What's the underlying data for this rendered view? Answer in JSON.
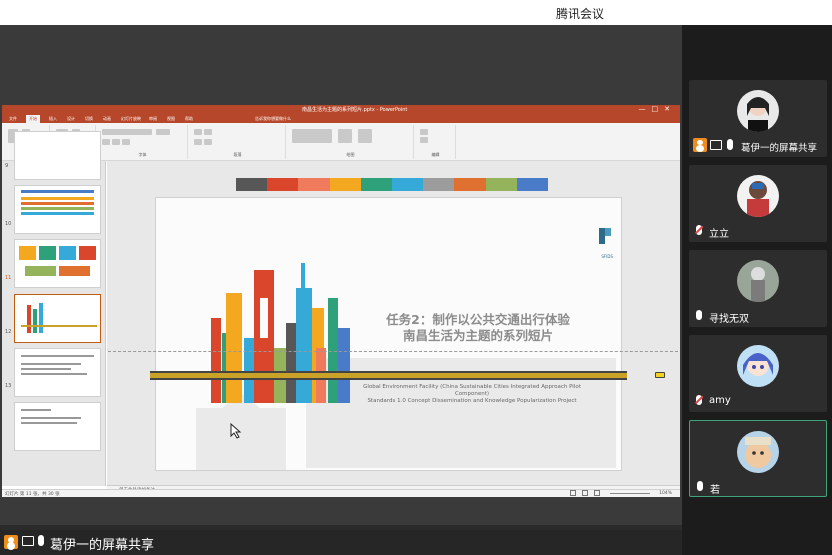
{
  "app": {
    "title": "腾讯会议"
  },
  "ppt": {
    "doc_title": "南昌生活为主题的系列短片.pptx - PowerPoint",
    "tabs": [
      "文件",
      "开始",
      "插入",
      "设计",
      "切换",
      "动画",
      "幻灯片放映",
      "审阅",
      "视图",
      "帮助",
      "告诉我你想要做什么"
    ],
    "ribbon_groups": [
      "剪贴板",
      "幻灯片",
      "字体",
      "段落",
      "绘图",
      "编辑"
    ],
    "thumbnail_numbers": [
      "9",
      "10",
      "11",
      "12",
      "13"
    ],
    "slide": {
      "title_line1": "任务2：制作以公共交通出行体验",
      "title_line2": "南昌生活为主题的系列短片",
      "subtitle_line1": "Global Environment Facility (China Sustainable Cities Integrated Approach Pilot Component)",
      "subtitle_line2": "Standards 1.0 Concept Dissemination and Knowledge Popularization Project",
      "logo_text": "SFIDS",
      "color_swatches": [
        "#575757",
        "#d9462b",
        "#ef7b5c",
        "#f3a81f",
        "#2ea17b",
        "#35a9d7",
        "#9c9c9c",
        "#e07030",
        "#95b35a",
        "#4a7bc8"
      ]
    },
    "notes_placeholder": "单击此处添加备注",
    "status_left": "幻灯片 第 11 张，共 30 张",
    "zoom": "104%"
  },
  "share_bar": {
    "label": "葛伊一的屏幕共享"
  },
  "participants": [
    {
      "name": "葛伊一的屏幕共享",
      "presenting": true
    },
    {
      "name": "立立",
      "muted": true
    },
    {
      "name": "寻找无双",
      "muted": false
    },
    {
      "name": "amy",
      "muted": true
    },
    {
      "name": "若",
      "muted": false,
      "active": true
    }
  ]
}
